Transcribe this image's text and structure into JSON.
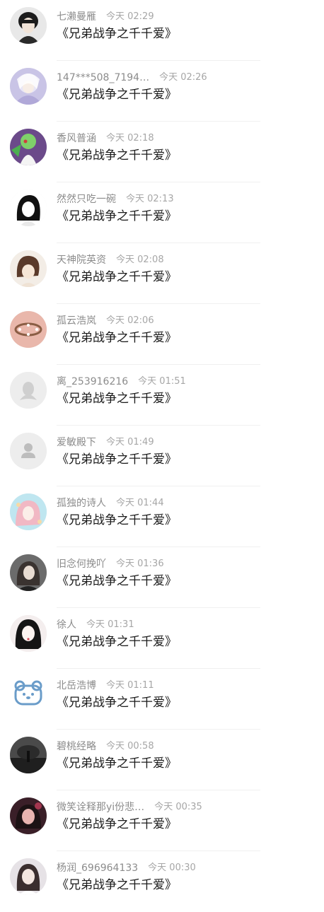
{
  "colors": {
    "name": "#8c8c8c",
    "time": "#a6a6a6",
    "message": "#1a1a1a",
    "divider": "#f0f0f0"
  },
  "messages": [
    {
      "name": "七濑曼雁",
      "time": "今天 02:29",
      "text": "《兄弟战争之千千爱》",
      "avatar": "boy-dark"
    },
    {
      "name": "147***508_7194…",
      "time": "今天 02:26",
      "text": "《兄弟战争之千千爱》",
      "avatar": "anime-silver"
    },
    {
      "name": "香风普涵",
      "time": "今天 02:18",
      "text": "《兄弟战争之千千爱》",
      "avatar": "green-creature"
    },
    {
      "name": "然然只吃一碗",
      "time": "今天 02:13",
      "text": "《兄弟战争之千千爱》",
      "avatar": "sketch-girl"
    },
    {
      "name": "天神院英资",
      "time": "今天 02:08",
      "text": "《兄弟战争之千千爱》",
      "avatar": "brown-hair"
    },
    {
      "name": "孤云浩岚",
      "time": "今天 02:06",
      "text": "《兄弟战争之千千爱》",
      "avatar": "bracelet-pink"
    },
    {
      "name": "离_253916216",
      "time": "今天 01:51",
      "text": "《兄弟战争之千千爱》",
      "avatar": "default-penguin"
    },
    {
      "name": "爱敏殿下",
      "time": "今天 01:49",
      "text": "《兄弟战争之千千爱》",
      "avatar": "default-person"
    },
    {
      "name": "孤独的诗人",
      "time": "今天 01:44",
      "text": "《兄弟战争之千千爱》",
      "avatar": "anime-pink"
    },
    {
      "name": "旧念何挽吖",
      "time": "今天 01:36",
      "text": "《兄弟战争之千千爱》",
      "avatar": "photo-girl"
    },
    {
      "name": "徐人",
      "time": "今天 01:31",
      "text": "《兄弟战争之千千爱》",
      "avatar": "dark-hair-girl"
    },
    {
      "name": "北岳浩博",
      "time": "今天 01:11",
      "text": "《兄弟战争之千千爱》",
      "avatar": "bear-icon"
    },
    {
      "name": "碧桃经略",
      "time": "今天 00:58",
      "text": "《兄弟战争之千千爱》",
      "avatar": "dark-silhouette"
    },
    {
      "name": "微笑诠释那yi份悲…",
      "time": "今天 00:35",
      "text": "《兄弟战争之千千爱》",
      "avatar": "red-light-girl"
    },
    {
      "name": "杨润_696964133",
      "time": "今天 00:30",
      "text": "《兄弟战争之千千爱》",
      "avatar": "photo-girl-2"
    }
  ]
}
